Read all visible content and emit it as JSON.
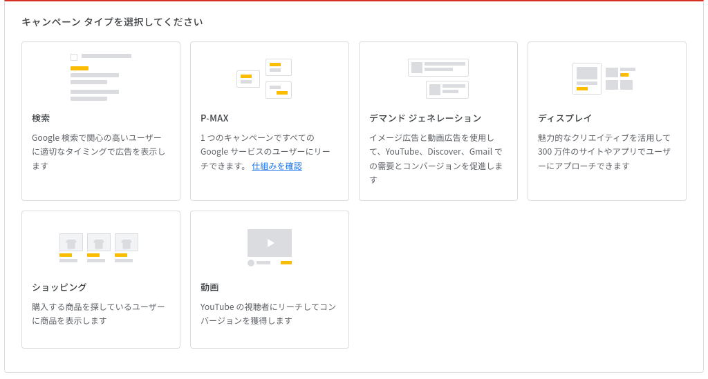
{
  "panel": {
    "title": "キャンペーン タイプを選択してください"
  },
  "cards": [
    {
      "key": "search",
      "title": "検索",
      "desc": "Google 検索で関心の高いユーザーに適切なタイミングで広告を表示します",
      "link": null
    },
    {
      "key": "pmax",
      "title": "P-MAX",
      "desc": "1 つのキャンペーンですべての Google サービスのユーザーにリーチできます。",
      "link": "仕組みを確認"
    },
    {
      "key": "demand",
      "title": "デマンド ジェネレーション",
      "desc": "イメージ広告と動画広告を使用して、YouTube、Discover、Gmail での需要とコンバージョンを促進します",
      "link": null
    },
    {
      "key": "display",
      "title": "ディスプレイ",
      "desc": "魅力的なクリエイティブを活用して 300 万件のサイトやアプリでユーザーにアプローチできます",
      "link": null
    },
    {
      "key": "shopping",
      "title": "ショッピング",
      "desc": "購入する商品を探しているユーザーに商品を表示します",
      "link": null
    },
    {
      "key": "video",
      "title": "動画",
      "desc": "YouTube の視聴者にリーチしてコンバージョンを獲得します",
      "link": null
    }
  ]
}
